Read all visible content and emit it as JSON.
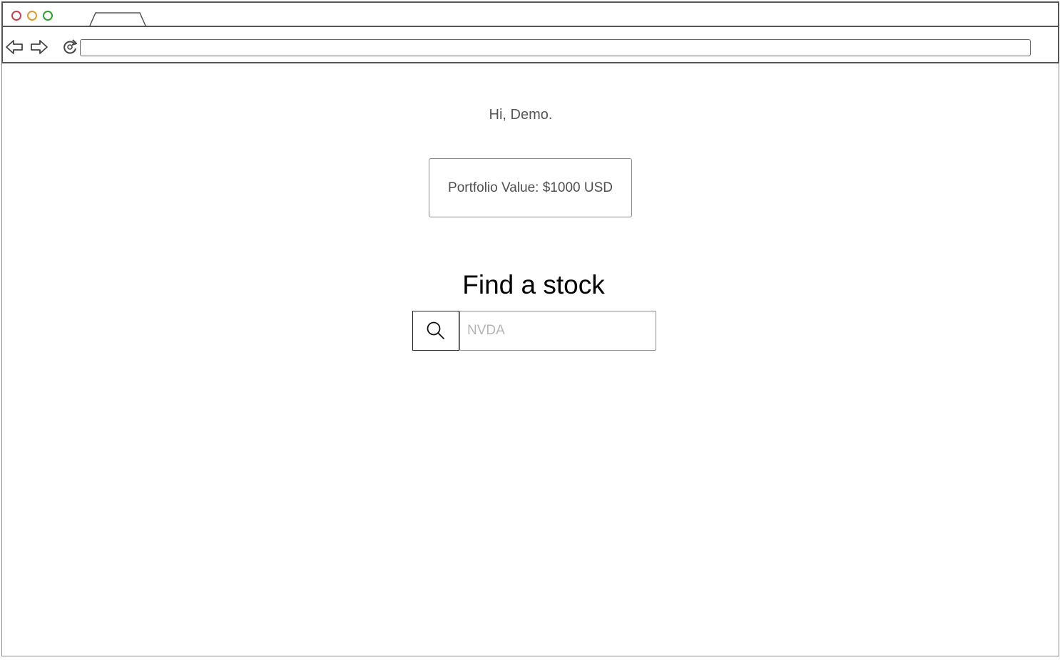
{
  "browser": {
    "tab_title": "",
    "address": ""
  },
  "page": {
    "greeting": "Hi, Demo.",
    "portfolio_value": "Portfolio Value: $1000 USD",
    "search_title": "Find a stock",
    "search_placeholder": "NVDA"
  },
  "icons": {
    "back": "back-arrow-icon",
    "forward": "forward-arrow-icon",
    "reload": "reload-icon",
    "search": "search-icon"
  },
  "colors": {
    "close": "#c8404f",
    "minimize": "#e09a2a",
    "maximize": "#2f9e2f"
  }
}
